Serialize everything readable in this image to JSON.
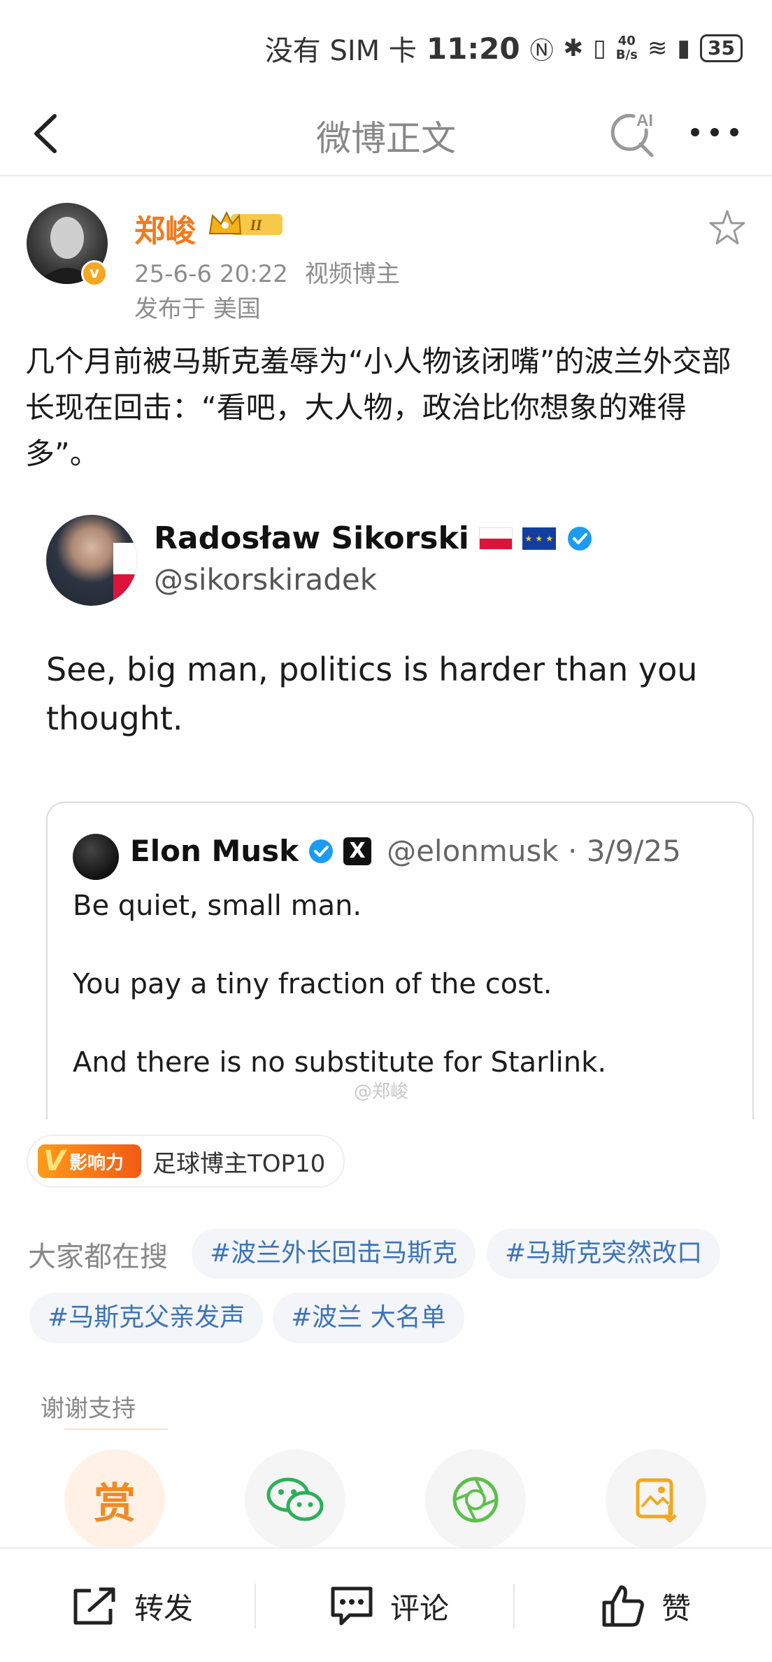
{
  "status_bar": {
    "carrier": "没有 SIM 卡",
    "time": "11:20",
    "net_speed_value": "40",
    "net_speed_unit": "B/s",
    "battery": "35"
  },
  "nav": {
    "title": "微博正文",
    "ai_label": "AI"
  },
  "author": {
    "name": "郑峻",
    "vip_level": "II",
    "badge": "v",
    "date": "25-6-6 20:22",
    "role": "视频博主",
    "location": "发布于 美国"
  },
  "post": {
    "text": "几个月前被马斯克羞辱为“小人物该闭嘴”的波兰外交部长现在回击：“看吧，大人物，政治比你想象的难得多”。"
  },
  "embed": {
    "tweet": {
      "name": "Radosław Sikorski",
      "handle": "@sikorskiradek",
      "text": "See, big man, politics is harder than you thought.",
      "eu_flag_stars": "★ ★ ★"
    },
    "quoted": {
      "name": "Elon Musk",
      "x_logo": "X",
      "handle": "@elonmusk · 3/9/25",
      "line1": "Be quiet, small man.",
      "line2": "You pay a tiny fraction of the cost.",
      "line3": "And there is no substitute for Starlink."
    },
    "watermark": "@郑峻"
  },
  "influence": {
    "badge_v": "V",
    "badge_text": "影响力",
    "label": "足球博主TOP10"
  },
  "search": {
    "label": "大家都在搜",
    "tags": [
      "#波兰外长回击马斯克",
      "#马斯克突然改口",
      "#马斯克父亲发声",
      "#波兰 大名单"
    ]
  },
  "support": {
    "title": "谢谢支持",
    "reward_label": "赏"
  },
  "bottom_bar": {
    "repost": "转发",
    "comment": "评论",
    "like": "赞"
  },
  "colors": {
    "author_name": "#f07a1d",
    "tag_text": "#3c74b8",
    "verified_blue": "#1d9bf0"
  }
}
